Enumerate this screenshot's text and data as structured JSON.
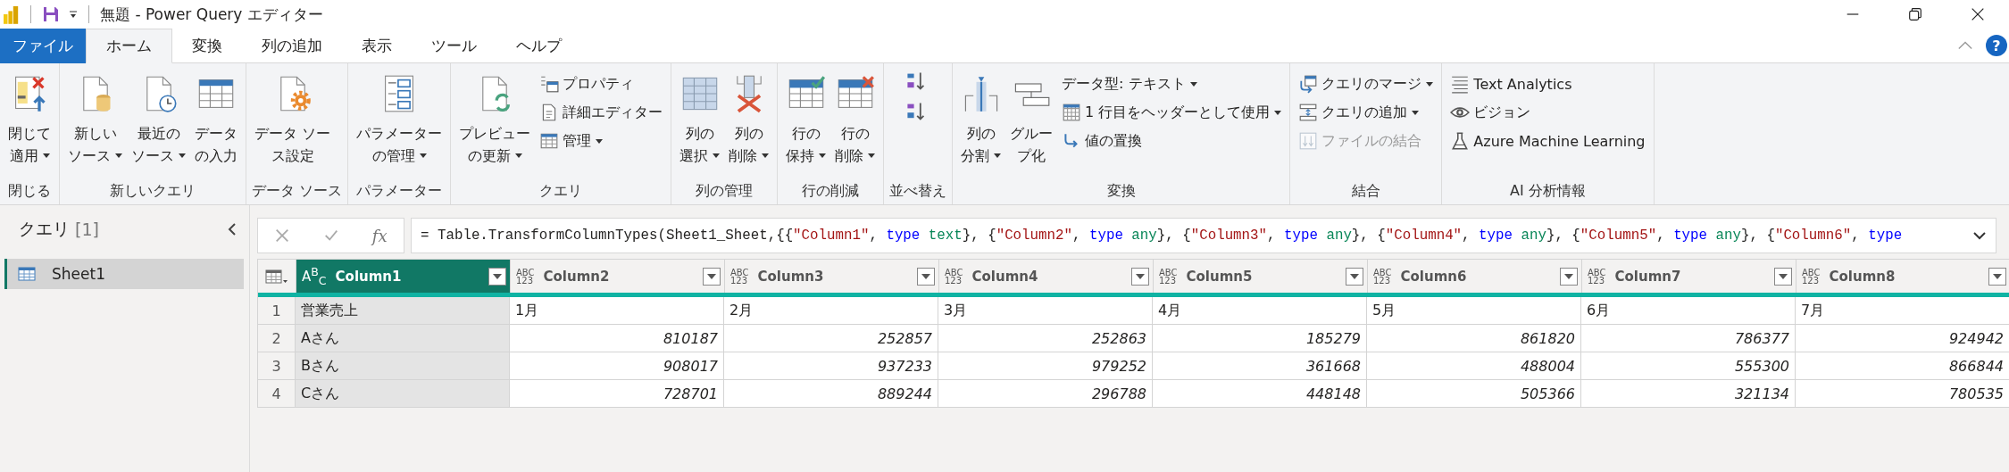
{
  "window": {
    "title": "無題 - Power Query エディター",
    "help": "?"
  },
  "menu_tabs": [
    {
      "label": "ファイル",
      "kind": "file",
      "selected": false
    },
    {
      "label": "ホーム",
      "kind": "tab",
      "selected": true
    },
    {
      "label": "変換",
      "kind": "tab",
      "selected": false
    },
    {
      "label": "列の追加",
      "kind": "tab",
      "selected": false
    },
    {
      "label": "表示",
      "kind": "tab",
      "selected": false
    },
    {
      "label": "ツール",
      "kind": "tab",
      "selected": false
    },
    {
      "label": "ヘルプ",
      "kind": "tab",
      "selected": false
    }
  ],
  "ribbon_groups": [
    {
      "label": "閉じる",
      "columns": [
        [
          {
            "kind": "large",
            "lines": [
              "閉じて",
              "適用"
            ],
            "dropdown": true
          }
        ]
      ]
    },
    {
      "label": "新しいクエリ",
      "columns": [
        [
          {
            "kind": "large",
            "lines": [
              "新しい",
              "ソース"
            ],
            "dropdown": true
          }
        ],
        [
          {
            "kind": "large",
            "lines": [
              "最近の",
              "ソース"
            ],
            "dropdown": true
          }
        ],
        [
          {
            "kind": "large",
            "lines": [
              "データ",
              "の入力"
            ],
            "dropdown": false
          }
        ]
      ]
    },
    {
      "label": "データ ソース",
      "columns": [
        [
          {
            "kind": "large",
            "lines": [
              "データ ソー",
              "ス設定"
            ],
            "dropdown": false
          }
        ]
      ]
    },
    {
      "label": "パラメーター",
      "columns": [
        [
          {
            "kind": "large",
            "lines": [
              "パラメーター",
              "の管理"
            ],
            "dropdown": true
          }
        ]
      ]
    },
    {
      "label": "クエリ",
      "columns": [
        [
          {
            "kind": "large",
            "lines": [
              "プレビュー",
              "の更新"
            ],
            "dropdown": true
          }
        ],
        [
          {
            "kind": "small",
            "label": "プロパティ",
            "dropdown": false,
            "disabled": false
          },
          {
            "kind": "small",
            "label": "詳細エディター",
            "dropdown": false,
            "disabled": false
          },
          {
            "kind": "small",
            "label": "管理",
            "dropdown": true,
            "disabled": false
          }
        ]
      ]
    },
    {
      "label": "列の管理",
      "columns": [
        [
          {
            "kind": "large",
            "lines": [
              "列の",
              "選択"
            ],
            "dropdown": true
          }
        ],
        [
          {
            "kind": "large",
            "lines": [
              "列の",
              "削除"
            ],
            "dropdown": true
          }
        ]
      ]
    },
    {
      "label": "行の削減",
      "columns": [
        [
          {
            "kind": "large",
            "lines": [
              "行の",
              "保持"
            ],
            "dropdown": true
          }
        ],
        [
          {
            "kind": "large",
            "lines": [
              "行の",
              "削除"
            ],
            "dropdown": true
          }
        ]
      ]
    },
    {
      "label": "並べ替え",
      "columns": [
        [
          {
            "kind": "icon_only"
          },
          {
            "kind": "icon_only"
          }
        ]
      ]
    },
    {
      "label": "変換",
      "columns": [
        [
          {
            "kind": "large",
            "lines": [
              "列の",
              "分割"
            ],
            "dropdown": true
          }
        ],
        [
          {
            "kind": "large",
            "lines": [
              "グルー",
              "プ化"
            ],
            "dropdown": false
          }
        ],
        [
          {
            "kind": "small",
            "label": "データ型: テキスト",
            "dropdown": true,
            "disabled": false
          },
          {
            "kind": "small",
            "label": "1 行目をヘッダーとして使用",
            "dropdown": true,
            "disabled": false
          },
          {
            "kind": "small",
            "label": "値の置換",
            "dropdown": false,
            "disabled": false
          }
        ]
      ]
    },
    {
      "label": "結合",
      "columns": [
        [
          {
            "kind": "small",
            "label": "クエリのマージ",
            "dropdown": true,
            "disabled": false
          },
          {
            "kind": "small",
            "label": "クエリの追加",
            "dropdown": true,
            "disabled": false
          },
          {
            "kind": "small",
            "label": "ファイルの結合",
            "dropdown": false,
            "disabled": true
          }
        ]
      ]
    },
    {
      "label": "AI 分析情報",
      "columns": [
        [
          {
            "kind": "small",
            "label": "Text Analytics",
            "dropdown": false,
            "disabled": false
          },
          {
            "kind": "small",
            "label": "ビジョン",
            "dropdown": false,
            "disabled": false
          },
          {
            "kind": "small",
            "label": "Azure Machine Learning",
            "dropdown": false,
            "disabled": false
          }
        ]
      ]
    }
  ],
  "queries_panel": {
    "title": "クエリ",
    "count": "[1]",
    "items": [
      {
        "label": "Sheet1",
        "selected": true
      }
    ]
  },
  "formula_bar": {
    "fx": "fx",
    "tokens": [
      {
        "kind": "plain",
        "text": "= Table.TransformColumnTypes(Sheet1_Sheet,{{"
      },
      {
        "kind": "string",
        "text": "\"Column1\""
      },
      {
        "kind": "plain",
        "text": ", "
      },
      {
        "kind": "keyword",
        "text": "type"
      },
      {
        "kind": "typename",
        "text": " text"
      },
      {
        "kind": "plain",
        "text": "}, {"
      },
      {
        "kind": "string",
        "text": "\"Column2\""
      },
      {
        "kind": "plain",
        "text": ", "
      },
      {
        "kind": "keyword",
        "text": "type"
      },
      {
        "kind": "typename",
        "text": " any"
      },
      {
        "kind": "plain",
        "text": "}, {"
      },
      {
        "kind": "string",
        "text": "\"Column3\""
      },
      {
        "kind": "plain",
        "text": ", "
      },
      {
        "kind": "keyword",
        "text": "type"
      },
      {
        "kind": "typename",
        "text": " any"
      },
      {
        "kind": "plain",
        "text": "}, {"
      },
      {
        "kind": "string",
        "text": "\"Column4\""
      },
      {
        "kind": "plain",
        "text": ", "
      },
      {
        "kind": "keyword",
        "text": "type"
      },
      {
        "kind": "typename",
        "text": " any"
      },
      {
        "kind": "plain",
        "text": "}, {"
      },
      {
        "kind": "string",
        "text": "\"Column5\""
      },
      {
        "kind": "plain",
        "text": ", "
      },
      {
        "kind": "keyword",
        "text": "type"
      },
      {
        "kind": "typename",
        "text": " any"
      },
      {
        "kind": "plain",
        "text": "}, {"
      },
      {
        "kind": "string",
        "text": "\"Column6\""
      },
      {
        "kind": "plain",
        "text": ", "
      },
      {
        "kind": "keyword",
        "text": "type"
      }
    ]
  },
  "table": {
    "columns": [
      {
        "name": "Column1",
        "type_glyph": [
          "A$^{B}$$_{C}$"
        ],
        "selected": true
      },
      {
        "name": "Column2",
        "type_glyph": [
          "ABC",
          "123"
        ],
        "selected": false
      },
      {
        "name": "Column3",
        "type_glyph": [
          "ABC",
          "123"
        ],
        "selected": false
      },
      {
        "name": "Column4",
        "type_glyph": [
          "ABC",
          "123"
        ],
        "selected": false
      },
      {
        "name": "Column5",
        "type_glyph": [
          "ABC",
          "123"
        ],
        "selected": false
      },
      {
        "name": "Column6",
        "type_glyph": [
          "ABC",
          "123"
        ],
        "selected": false
      },
      {
        "name": "Column7",
        "type_glyph": [
          "ABC",
          "123"
        ],
        "selected": false
      },
      {
        "name": "Column8",
        "type_glyph": [
          "ABC",
          "123"
        ],
        "selected": false
      }
    ],
    "rows": [
      {
        "number": "1",
        "cells": [
          {
            "text": "営業売上",
            "kind": "text"
          },
          {
            "text": "1月",
            "kind": "text"
          },
          {
            "text": "2月",
            "kind": "text"
          },
          {
            "text": "3月",
            "kind": "text"
          },
          {
            "text": "4月",
            "kind": "text"
          },
          {
            "text": "5月",
            "kind": "text"
          },
          {
            "text": "6月",
            "kind": "text"
          },
          {
            "text": "7月",
            "kind": "text"
          }
        ]
      },
      {
        "number": "2",
        "cells": [
          {
            "text": "Aさん",
            "kind": "text"
          },
          {
            "text": "810187",
            "kind": "number"
          },
          {
            "text": "252857",
            "kind": "number"
          },
          {
            "text": "252863",
            "kind": "number"
          },
          {
            "text": "185279",
            "kind": "number"
          },
          {
            "text": "861820",
            "kind": "number"
          },
          {
            "text": "786377",
            "kind": "number"
          },
          {
            "text": "924942",
            "kind": "number"
          }
        ]
      },
      {
        "number": "3",
        "cells": [
          {
            "text": "Bさん",
            "kind": "text"
          },
          {
            "text": "908017",
            "kind": "number"
          },
          {
            "text": "937233",
            "kind": "number"
          },
          {
            "text": "979252",
            "kind": "number"
          },
          {
            "text": "361668",
            "kind": "number"
          },
          {
            "text": "488004",
            "kind": "number"
          },
          {
            "text": "555300",
            "kind": "number"
          },
          {
            "text": "866844",
            "kind": "number"
          }
        ]
      },
      {
        "number": "4",
        "cells": [
          {
            "text": "Cさん",
            "kind": "text"
          },
          {
            "text": "728701",
            "kind": "number"
          },
          {
            "text": "889244",
            "kind": "number"
          },
          {
            "text": "296788",
            "kind": "number"
          },
          {
            "text": "448148",
            "kind": "number"
          },
          {
            "text": "505366",
            "kind": "number"
          },
          {
            "text": "321134",
            "kind": "number"
          },
          {
            "text": "780535",
            "kind": "number"
          }
        ]
      }
    ]
  }
}
